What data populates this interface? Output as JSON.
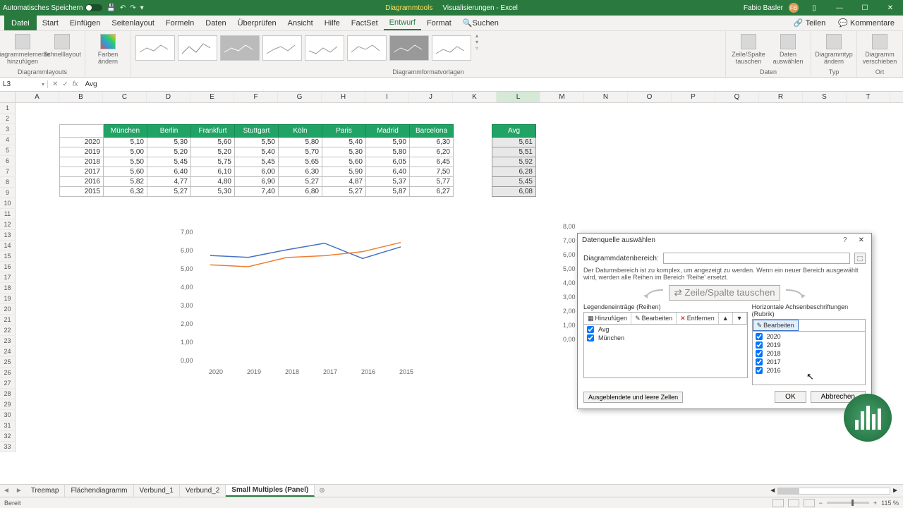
{
  "titlebar": {
    "autosave": "Automatisches Speichern",
    "center_tool": "Diagrammtools",
    "center_doc": "Visualisierungen - Excel",
    "user": "Fabio Basler",
    "user_initials": "FB"
  },
  "ribbon_tabs": [
    "Datei",
    "Start",
    "Einfügen",
    "Seitenlayout",
    "Formeln",
    "Daten",
    "Überprüfen",
    "Ansicht",
    "Hilfe",
    "FactSet",
    "Entwurf",
    "Format",
    "Suchen"
  ],
  "ribbon_active": "Entwurf",
  "ribbon_right": {
    "share": "Teilen",
    "comments": "Kommentare"
  },
  "ribbon_groups": {
    "layouts": "Diagrammlayouts",
    "layouts_btn1": "Diagrammelemente hinzufügen",
    "layouts_btn2": "Schnelllayout",
    "colors": "Farben ändern",
    "styles": "Diagrammformatvorlagen",
    "data": "Daten",
    "data_btn1": "Zeile/Spalte tauschen",
    "data_btn2": "Daten auswählen",
    "type": "Typ",
    "type_btn": "Diagrammtyp ändern",
    "location": "Ort",
    "location_btn": "Diagramm verschieben"
  },
  "namebox": "L3",
  "formula": "Avg",
  "columns": [
    "A",
    "B",
    "C",
    "D",
    "E",
    "F",
    "G",
    "H",
    "I",
    "J",
    "K",
    "L",
    "M",
    "N",
    "O",
    "P",
    "Q",
    "R",
    "S",
    "T"
  ],
  "table": {
    "headers": [
      "",
      "München",
      "Berlin",
      "Frankfurt",
      "Stuttgart",
      "Köln",
      "Paris",
      "Madrid",
      "Barcelona"
    ],
    "rows": [
      [
        "2020",
        "5,10",
        "5,30",
        "5,60",
        "5,50",
        "5,80",
        "5,40",
        "5,90",
        "6,30"
      ],
      [
        "2019",
        "5,00",
        "5,20",
        "5,20",
        "5,40",
        "5,70",
        "5,30",
        "5,80",
        "6,20"
      ],
      [
        "2018",
        "5,50",
        "5,45",
        "5,75",
        "5,45",
        "5,65",
        "5,60",
        "6,05",
        "6,45"
      ],
      [
        "2017",
        "5,60",
        "6,40",
        "6,10",
        "6,00",
        "6,30",
        "5,90",
        "6,40",
        "7,50"
      ],
      [
        "2016",
        "5,82",
        "4,77",
        "4,80",
        "6,90",
        "5,27",
        "4,87",
        "5,37",
        "5,77"
      ],
      [
        "2015",
        "6,32",
        "5,27",
        "5,30",
        "7,40",
        "6,80",
        "5,27",
        "5,87",
        "6,27"
      ]
    ]
  },
  "avg": {
    "header": "Avg",
    "values": [
      "5,61",
      "5,51",
      "5,92",
      "6,28",
      "5,45",
      "6,08"
    ]
  },
  "chart_data": {
    "type": "line",
    "categories": [
      "2020",
      "2019",
      "2018",
      "2017",
      "2016",
      "2015"
    ],
    "series": [
      {
        "name": "Avg",
        "values": [
          5.61,
          5.51,
          5.92,
          6.28,
          5.45,
          6.08
        ]
      },
      {
        "name": "München",
        "values": [
          5.1,
          5.0,
          5.5,
          5.6,
          5.82,
          6.32
        ]
      }
    ],
    "ylim": [
      0,
      7
    ],
    "yticks": [
      "0,00",
      "1,00",
      "2,00",
      "3,00",
      "4,00",
      "5,00",
      "6,00",
      "7,00"
    ],
    "xlabel": "",
    "ylabel": "",
    "title": ""
  },
  "left_axis_ghost": [
    "8,00",
    "7,00",
    "6,00",
    "5,00",
    "4,00",
    "3,00",
    "2,00",
    "1,00",
    "0,00"
  ],
  "dialog": {
    "title": "Datenquelle auswählen",
    "range_label": "Diagrammdatenbereich:",
    "note": "Der Datumsbereich ist zu komplex, um angezeigt zu werden. Wenn ein neuer Bereich ausgewählt wird, werden alle Reihen im Bereich 'Reihe' ersetzt.",
    "swap": "Zeile/Spalte tauschen",
    "legend_header": "Legendeneinträge (Reihen)",
    "legend_buttons": {
      "add": "Hinzufügen",
      "edit": "Bearbeiten",
      "remove": "Entfernen"
    },
    "legend_items": [
      "Avg",
      "München"
    ],
    "axis_header": "Horizontale Achsenbeschriftungen (Rubrik)",
    "axis_edit": "Bearbeiten",
    "axis_items": [
      "2020",
      "2019",
      "2018",
      "2017",
      "2016"
    ],
    "hidden": "Ausgeblendete und leere Zellen",
    "ok": "OK",
    "cancel": "Abbrechen"
  },
  "sheets": [
    "Treemap",
    "Flächendiagramm",
    "Verbund_1",
    "Verbund_2",
    "Small Multiples (Panel)"
  ],
  "sheet_active": 4,
  "status": {
    "ready": "Bereit",
    "zoom": "115 %"
  }
}
